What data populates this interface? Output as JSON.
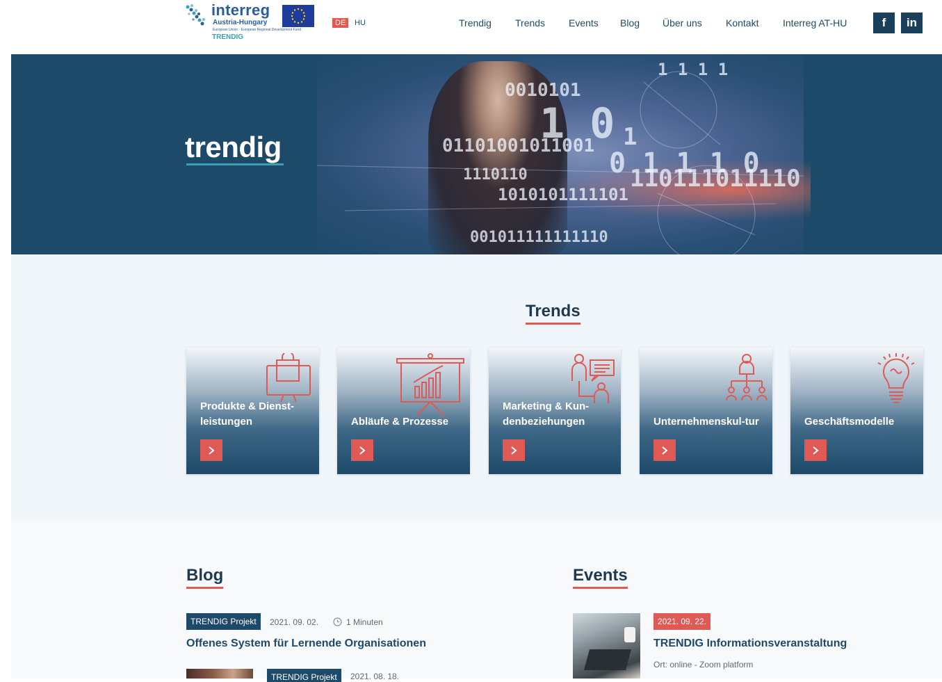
{
  "logo": {
    "brand": "interreg",
    "subtitle": "Austria-Hungary",
    "fund": "European Union · European Regional Development Fund",
    "project": "TRENDIG"
  },
  "languages": {
    "active": "DE",
    "other": "HU"
  },
  "nav": [
    "Trendig",
    "Trends",
    "Events",
    "Blog",
    "Über uns",
    "Kontakt",
    "Interreg AT-HU"
  ],
  "social": {
    "facebook": "f",
    "linkedin": "in"
  },
  "hero": {
    "wordmark": "trendig"
  },
  "trends": {
    "title": "Trends",
    "cards": [
      {
        "label": "Produkte & Dienst-leistungen",
        "icon": "shopping-bag-monitor-icon"
      },
      {
        "label": "Abläufe & Prozesse",
        "icon": "presentation-chart-icon"
      },
      {
        "label": "Marketing & Kun-denbeziehungen",
        "icon": "customer-chat-icon"
      },
      {
        "label": "Unternehmenskul-tur",
        "icon": "org-chart-icon"
      },
      {
        "label": "Geschäftsmodelle",
        "icon": "lightbulb-icon"
      }
    ]
  },
  "blog": {
    "title": "Blog",
    "posts": [
      {
        "tag": "TRENDIG Projekt",
        "date": "2021. 09. 02.",
        "read_time": "1 Minuten",
        "title": "Offenes System für Lernende Organisationen"
      },
      {
        "tag": "TRENDIG Projekt",
        "date": "2021. 08. 18."
      }
    ]
  },
  "events": {
    "title": "Events",
    "items": [
      {
        "date": "2021. 09. 22.",
        "title": "TRENDIG Informationsveranstaltung",
        "location": "Ort: online - Zoom platform"
      }
    ]
  },
  "colors": {
    "primary": "#1e4a6a",
    "accent": "#e05a55",
    "light_bg": "#f0f6fa"
  }
}
